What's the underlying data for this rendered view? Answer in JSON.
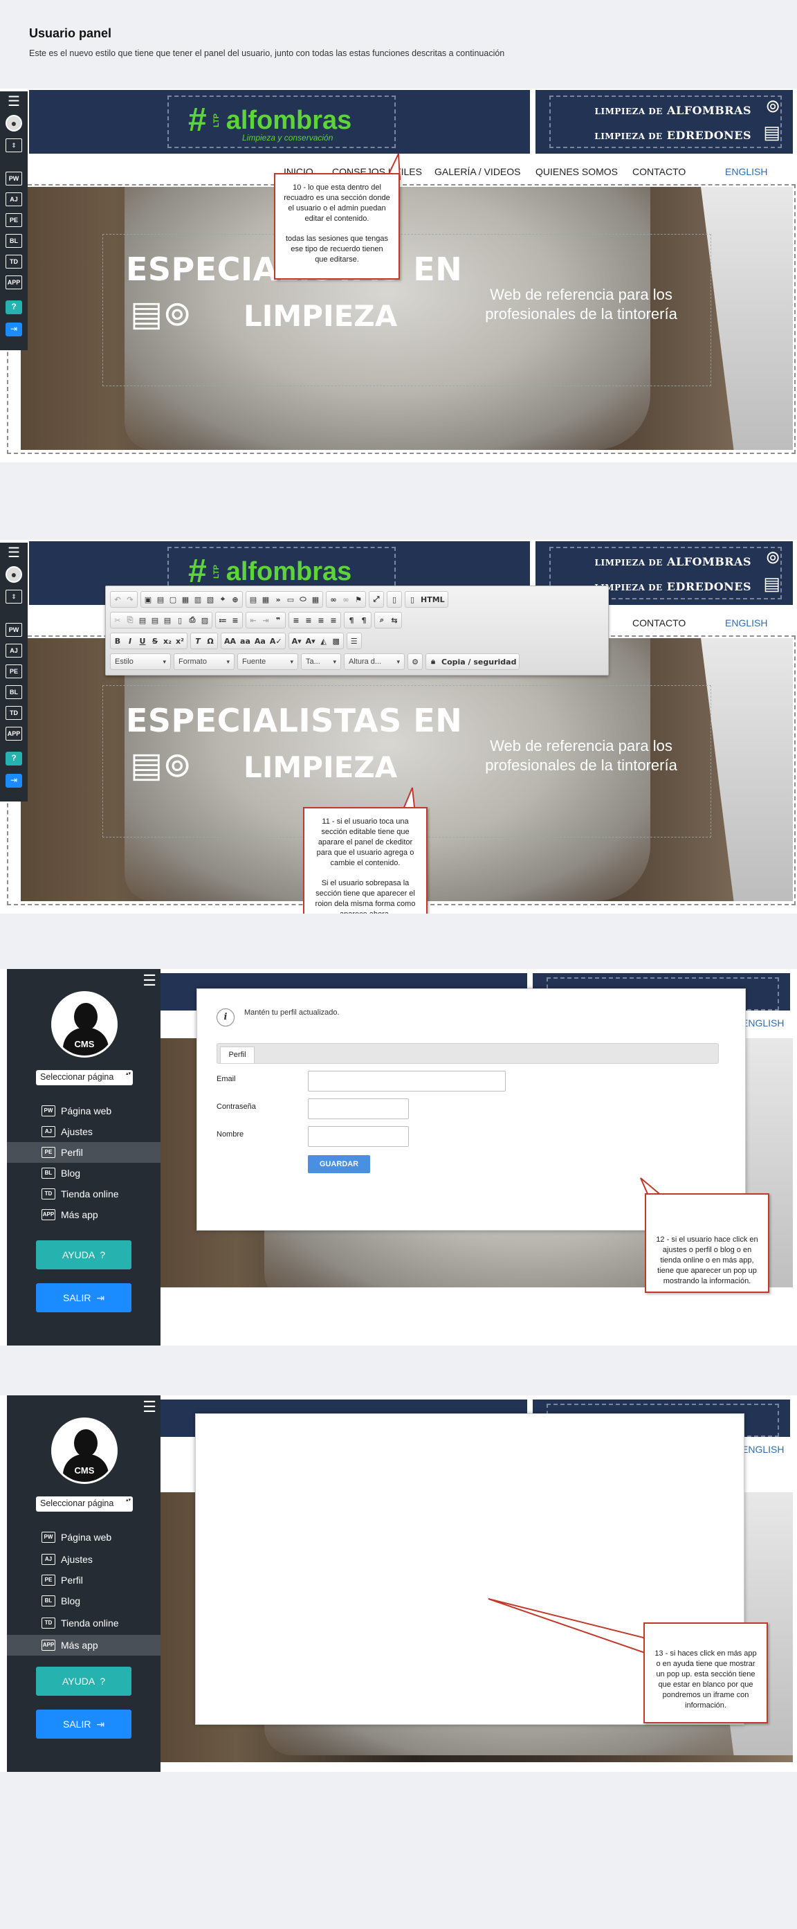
{
  "header": {
    "title": "Usuario panel",
    "subtitle": "Este es el nuevo estilo que tiene que tener el panel del usuario, junto con todas las estas funciones descritas a continuación"
  },
  "site": {
    "logo_name": "alfombras",
    "logo_prefix": "LTP",
    "logo_tagline": "Limpieza y conservación",
    "banner_line1_a": "LIMPIEZA DE",
    "banner_line1_b": "ALFOMBRAS",
    "banner_line2_a": "LIMPIEZA DE",
    "banner_line2_b": "EDREDONES",
    "nav": {
      "inicio": "INICIO",
      "consejos": "CONSEJOS ÚTILES",
      "galeria": "GALERÍA / VIDEOS",
      "quienes": "QUIENES SOMOS",
      "contacto": "CONTACTO",
      "english": "ENGLISH"
    },
    "hero": {
      "title": "ESPECIALISTAS EN",
      "title2": "LIMPIEZA",
      "tagline": "Web de referencia para los profesionales de la tintorería"
    }
  },
  "rail": {
    "tags": [
      "PW",
      "AJ",
      "PE",
      "BL",
      "TD",
      "APP"
    ],
    "help": "?"
  },
  "callouts": {
    "c10_p1": "10 - lo que esta dentro del recuadro es una sección donde el usuario o el admin puedan editar el contenido.",
    "c10_p2": "todas las sesiones que tengas ese tipo de recuerdo tienen que editarse.",
    "c11_p1": "11 - si el usuario toca una sección editable tiene que aparare el panel de ckeditor para que el usuario agrega o cambie el contenido.",
    "c11_p2": "Si el usuario sobrepasa la sección tiene que aparecer el roion dela misma forma como aparece ahora.",
    "c12": "12 - si el usuario hace click en ajustes o perfil o blog o en tienda online o en más app, tiene que aparecer un pop up mostrando la información.",
    "c13": "13 - si haces click en más app o en ayuda tiene que mostrar un pop up. esta sección tiene que estar en blanco por que pondremos un iframe con información."
  },
  "editor": {
    "html_label": "HTML",
    "style": "Estilo",
    "format": "Formato",
    "font": "Fuente",
    "size": "Ta...",
    "height": "Altura d...",
    "copy": "Copia / seguridad"
  },
  "sidebar": {
    "select": "Seleccionar página",
    "cms": "CMS",
    "items": [
      {
        "tag": "PW",
        "label": "Página web"
      },
      {
        "tag": "AJ",
        "label": "Ajustes"
      },
      {
        "tag": "PE",
        "label": "Perfil"
      },
      {
        "tag": "BL",
        "label": "Blog"
      },
      {
        "tag": "TD",
        "label": "Tienda online"
      },
      {
        "tag": "APP",
        "label": "Más app"
      }
    ],
    "help": "AYUDA",
    "exit": "SALIR"
  },
  "profile_modal": {
    "info": "Mantén tu perfil actualizado.",
    "tab": "Perfil",
    "email": "Email",
    "password": "Contraseña",
    "name": "Nombre",
    "save": "GUARDAR"
  }
}
